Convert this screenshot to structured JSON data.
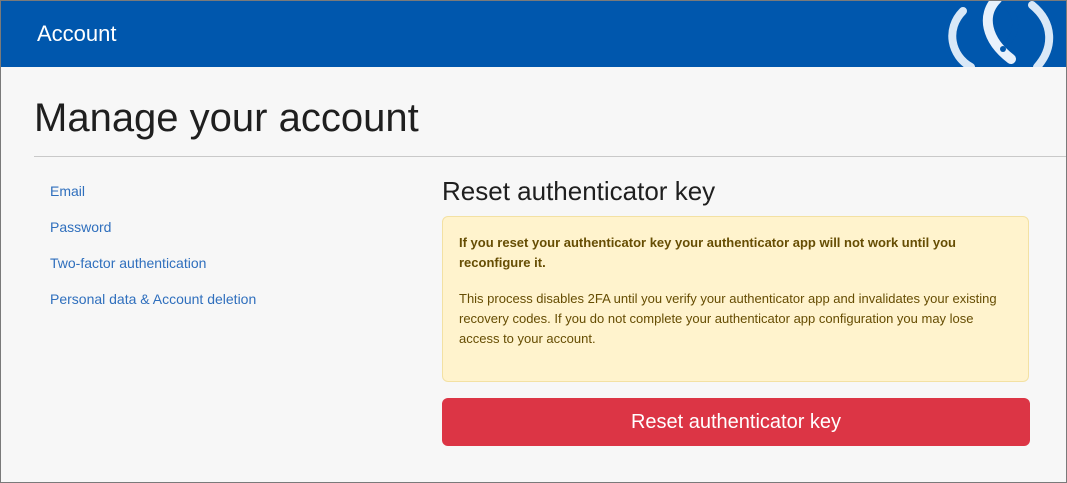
{
  "header": {
    "title": "Account",
    "background_color": "#0057ad",
    "logo_icon": "nuget-style-logo-icon"
  },
  "page": {
    "title": "Manage your account"
  },
  "sidebar": {
    "items": [
      {
        "label": "Email"
      },
      {
        "label": "Password"
      },
      {
        "label": "Two-factor authentication"
      },
      {
        "label": "Personal data & Account deletion"
      }
    ],
    "link_color": "#2f6fbd"
  },
  "main": {
    "title": "Reset authenticator key",
    "warning": {
      "strong_text": "If you reset your authenticator key your authenticator app will not work until you reconfigure it.",
      "body_text": "This process disables 2FA until you verify your authenticator app and invalidates your existing recovery codes. If you do not complete your authenticator app configuration you may lose access to your account.",
      "background_color": "#fff3cd",
      "text_color": "#664d03"
    },
    "reset_button_label": "Reset authenticator key",
    "reset_button_color": "#dc3545"
  }
}
